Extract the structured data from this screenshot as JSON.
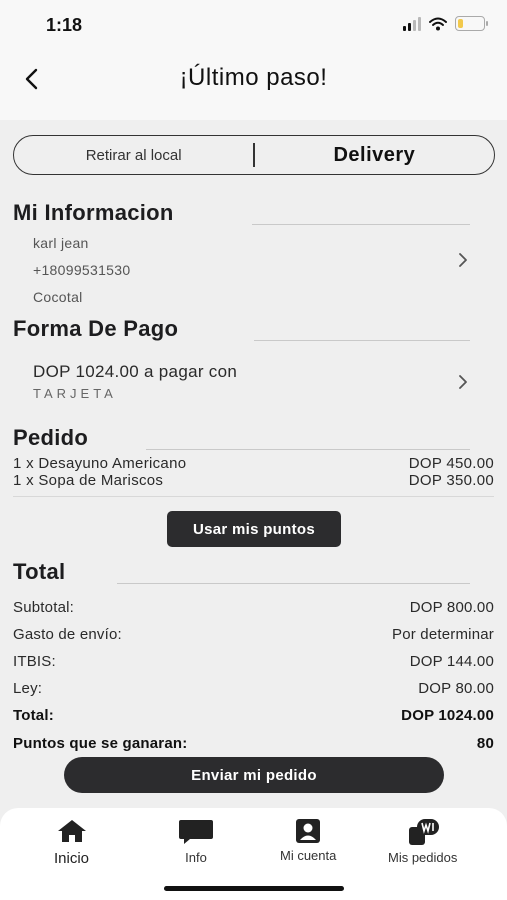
{
  "status": {
    "time": "1:18"
  },
  "header": {
    "title": "¡Último paso!"
  },
  "mode_toggle": {
    "pickup_label": "Retirar al local",
    "delivery_label": "Delivery",
    "selected": "Delivery"
  },
  "info": {
    "title": "Mi Informacion",
    "name": "karl jean",
    "phone": "+18099531530",
    "location": "Cocotal"
  },
  "payment": {
    "title": "Forma De Pago",
    "line": "DOP 1024.00 a pagar con",
    "method": "TARJETA"
  },
  "order": {
    "title": "Pedido",
    "items": [
      {
        "label": "1 x Desayuno Americano",
        "price": "DOP 450.00"
      },
      {
        "label": "1 x Sopa de Mariscos",
        "price": "DOP 350.00"
      }
    ],
    "points_button": "Usar mis puntos"
  },
  "totals": {
    "title": "Total",
    "rows": [
      {
        "label": "Subtotal:",
        "value": "DOP 800.00"
      },
      {
        "label": "Gasto de envío:",
        "value": "Por determinar"
      },
      {
        "label": "ITBIS:",
        "value": "DOP 144.00"
      },
      {
        "label": "Ley:",
        "value": "DOP 80.00"
      },
      {
        "label": "Total:",
        "value": "DOP 1024.00"
      },
      {
        "label": "Puntos que se ganaran:",
        "value": "80"
      }
    ]
  },
  "submit_button": "Enviar mi pedido",
  "tabs": [
    {
      "label": "Inicio",
      "icon": "home-icon"
    },
    {
      "label": "Info",
      "icon": "chat-icon"
    },
    {
      "label": "Mi cuenta",
      "icon": "account-icon"
    },
    {
      "label": "Mis pedidos",
      "icon": "orders-icon"
    }
  ],
  "colors": {
    "button_dark": "#2c2c2e",
    "background": "#efefef",
    "battery": "#f2c94c"
  }
}
